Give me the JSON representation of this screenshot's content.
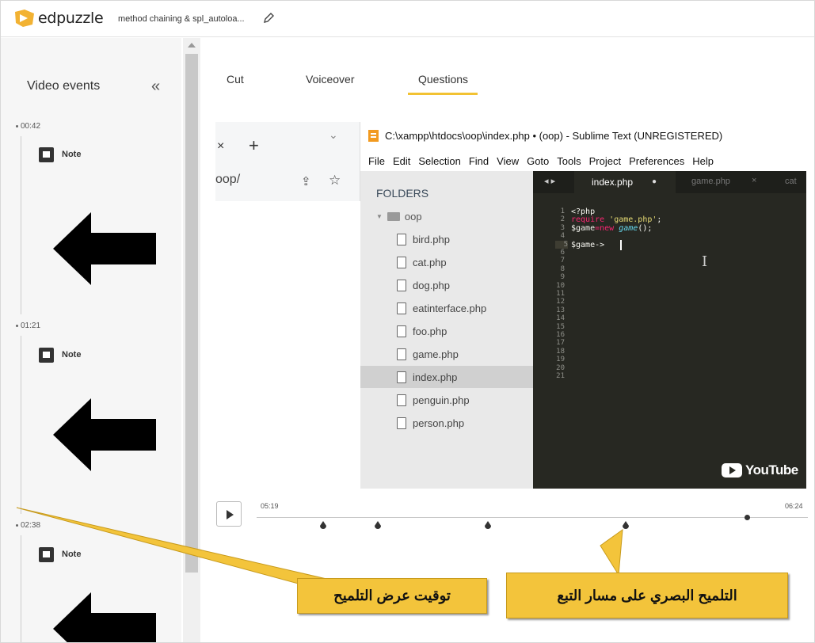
{
  "header": {
    "logo_text": "edpuzzle",
    "project_title": "method chaining & spl_autoloa..."
  },
  "sidebar": {
    "title": "Video events",
    "collapse_glyph": "«",
    "events": [
      {
        "time": "00:42",
        "type": "Note"
      },
      {
        "time": "01:21",
        "type": "Note"
      },
      {
        "time": "02:38",
        "type": "Note"
      }
    ]
  },
  "tabs": [
    {
      "label": "Cut",
      "active": false
    },
    {
      "label": "Voiceover",
      "active": false
    },
    {
      "label": "Questions",
      "active": true
    }
  ],
  "video": {
    "browser": {
      "close_glyph": "×",
      "plus_glyph": "+",
      "chevron_glyph": "⌄",
      "url_fragment": "oop/",
      "share_glyph": "⇪",
      "star_glyph": "☆"
    },
    "sublime": {
      "window_title": "C:\\xampp\\htdocs\\oop\\index.php • (oop) - Sublime Text (UNREGISTERED)",
      "menu": [
        "File",
        "Edit",
        "Selection",
        "Find",
        "View",
        "Goto",
        "Tools",
        "Project",
        "Preferences",
        "Help"
      ],
      "folders_label": "FOLDERS",
      "folder_name": "oop",
      "files": [
        "bird.php",
        "cat.php",
        "dog.php",
        "eatinterface.php",
        "foo.php",
        "game.php",
        "index.php",
        "penguin.php",
        "person.php"
      ],
      "selected_file": "index.php",
      "tab_nav": "◂ ▸",
      "active_tab": "index.php",
      "active_tab_dot": "●",
      "second_tab": "game.php",
      "second_tab_close": "×",
      "third_tab": "cat",
      "line_numbers": [
        "1",
        "2",
        "3",
        "4",
        "5",
        "6",
        "7",
        "8",
        "9",
        "10",
        "11",
        "12",
        "13",
        "14",
        "15",
        "16",
        "17",
        "18",
        "19",
        "20",
        "21"
      ],
      "code": {
        "l1": "<?php",
        "l2_kw": "require",
        "l2_str": " 'game.php'",
        "l2_end": ";",
        "l3_var": "$game",
        "l3_op": "=",
        "l3_kw": "new",
        "l3_fn": " game",
        "l3_end": "();",
        "l5": "$game->"
      },
      "watermark": "YouTube"
    }
  },
  "player": {
    "time_start": "05:19",
    "time_end": "06:24",
    "progress": 0.89,
    "marker_positions": [
      0.12,
      0.22,
      0.42,
      0.67
    ]
  },
  "annotations": {
    "left_callout": "توقيت عرض التلميح",
    "right_callout": "التلميح البصري على مسار التبع"
  },
  "colors": {
    "accent": "#f2c233",
    "callout": "#f3c43b",
    "editor_bg": "#272822"
  }
}
